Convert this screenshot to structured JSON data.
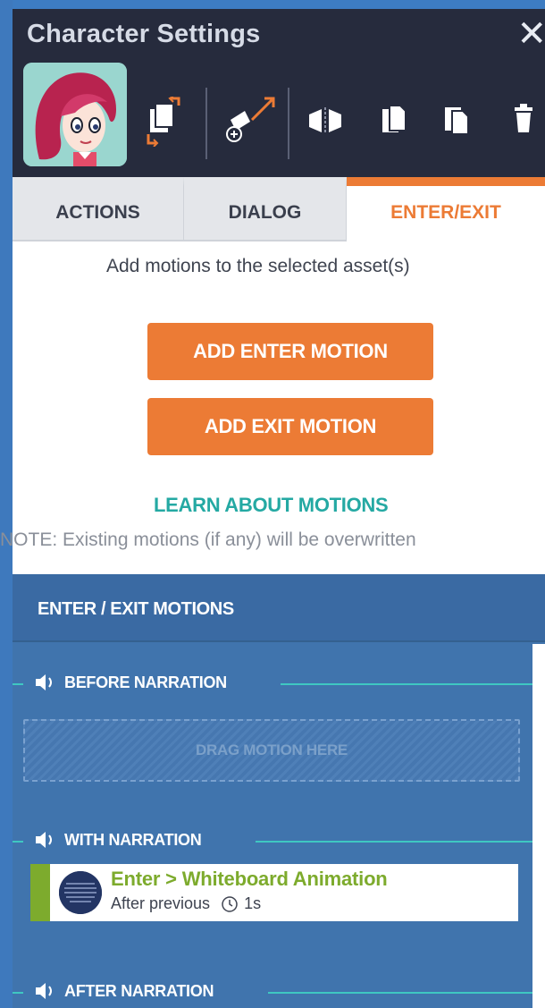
{
  "header": {
    "title": "Character Settings",
    "close_symbol": "✕"
  },
  "toolbar": {
    "icons": [
      "swap-character-icon",
      "replace-asset-icon",
      "flip-horizontal-icon",
      "copy-icon",
      "paste-icon",
      "delete-icon"
    ]
  },
  "tabs": [
    {
      "label": "ACTIONS",
      "active": false
    },
    {
      "label": "DIALOG",
      "active": false
    },
    {
      "label": "ENTER/EXIT",
      "active": true
    }
  ],
  "content": {
    "description": "Add motions to the selected asset(s)",
    "add_enter_label": "ADD ENTER MOTION",
    "add_exit_label": "ADD EXIT MOTION",
    "learn_link": "LEARN ABOUT MOTIONS",
    "note": "NOTE: Existing motions (if any) will be overwritten"
  },
  "panel": {
    "title": "ENTER / EXIT MOTIONS",
    "sections": [
      {
        "label": "BEFORE NARRATION"
      },
      {
        "label": "WITH NARRATION"
      },
      {
        "label": "AFTER NARRATION"
      }
    ],
    "dropzone_label": "DRAG MOTION HERE",
    "motion": {
      "title": "Enter > Whiteboard Animation",
      "timing": "After previous",
      "duration": "1s"
    }
  },
  "colors": {
    "header_bg": "#262b3d",
    "accent_orange": "#ec7b35",
    "link_teal": "#24a9a3",
    "panel_blue": "#4074ad",
    "motion_green": "#7dab2d"
  }
}
